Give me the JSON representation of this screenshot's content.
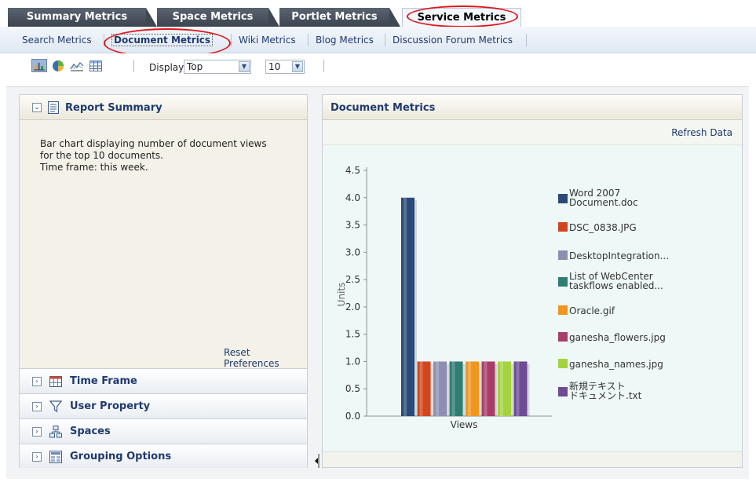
{
  "tabs": [
    {
      "label": "Summary Metrics"
    },
    {
      "label": "Space Metrics"
    },
    {
      "label": "Portlet Metrics"
    },
    {
      "label": "Service Metrics"
    }
  ],
  "subnav": [
    {
      "label": "Search Metrics"
    },
    {
      "label": "Document Metrics"
    },
    {
      "label": "Wiki Metrics"
    },
    {
      "label": "Blog Metrics"
    },
    {
      "label": "Discussion Forum Metrics"
    }
  ],
  "toolbar": {
    "icons": [
      "bar-chart-icon",
      "pie-chart-icon",
      "line-chart-icon",
      "table-icon"
    ],
    "display_label": "Display",
    "display_value": "Top",
    "count_value": "10"
  },
  "left_panel": {
    "title": "Report Summary",
    "description": [
      "Bar chart displaying number of document views",
      "for the top 10 documents.",
      "Time frame: this week."
    ],
    "reset_label": "Reset Preferences",
    "sections": [
      {
        "label": "Time Frame",
        "icon": "calendar-icon"
      },
      {
        "label": "User Property",
        "icon": "filter-icon"
      },
      {
        "label": "Spaces",
        "icon": "spaces-icon"
      },
      {
        "label": "Grouping Options",
        "icon": "grouping-icon"
      }
    ]
  },
  "right_panel": {
    "title": "Document Metrics",
    "refresh_label": "Refresh Data"
  },
  "chart_data": {
    "type": "bar",
    "categories": [
      "Views"
    ],
    "ylabel": "Units",
    "xlabel": "",
    "ylim": [
      0,
      4.5
    ],
    "yticks": [
      "4.5",
      "4.0",
      "3.5",
      "3.0",
      "2.5",
      "2.0",
      "1.5",
      "1.0",
      "0.5",
      "0.0"
    ],
    "grid": false,
    "legend_position": "right",
    "series": [
      {
        "name": "Word 2007 Document.doc",
        "label_lines": [
          "Word 2007",
          "Document.doc"
        ],
        "values": [
          4.0
        ],
        "color": "#2a4a78"
      },
      {
        "name": "DSC_0838.JPG",
        "label_lines": [
          "DSC_0838.JPG"
        ],
        "values": [
          1.0
        ],
        "color": "#d2461f"
      },
      {
        "name": "DesktopIntegration...",
        "label_lines": [
          "DesktopIntegration..."
        ],
        "values": [
          1.0
        ],
        "color": "#8d8fb2"
      },
      {
        "name": "List of WebCenter taskflows enabled...",
        "label_lines": [
          "List of WebCenter",
          "taskflows enabled..."
        ],
        "values": [
          1.0
        ],
        "color": "#2f7d73"
      },
      {
        "name": "Oracle.gif",
        "label_lines": [
          "Oracle.gif"
        ],
        "values": [
          1.0
        ],
        "color": "#f0951e"
      },
      {
        "name": "ganesha_flowers.jpg",
        "label_lines": [
          "ganesha_flowers.jpg"
        ],
        "values": [
          1.0
        ],
        "color": "#a83d6a"
      },
      {
        "name": "ganesha_names.jpg",
        "label_lines": [
          "ganesha_names.jpg"
        ],
        "values": [
          1.0
        ],
        "color": "#a5d33f"
      },
      {
        "name": "新規テキスト ドキュメント.txt",
        "label_lines": [
          "新規テキスト",
          "ドキュメント.txt"
        ],
        "values": [
          1.0
        ],
        "color": "#6e4b94"
      }
    ]
  }
}
